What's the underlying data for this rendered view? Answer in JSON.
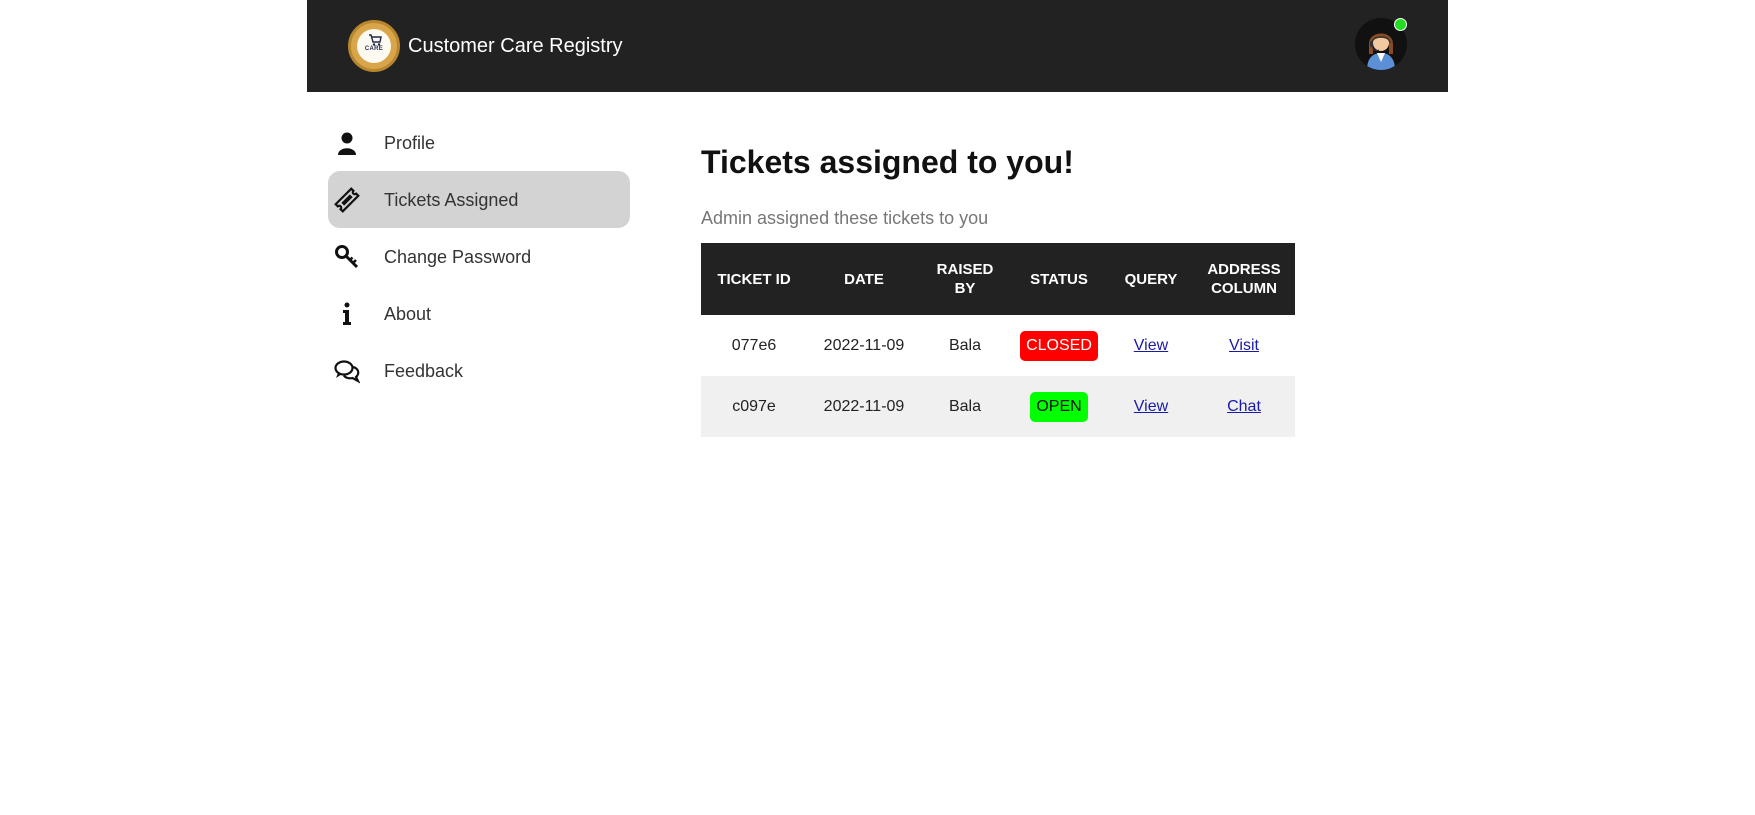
{
  "header": {
    "brand_title": "Customer Care Registry",
    "logo_text": "CARE",
    "avatar_icon": "agent-avatar-icon",
    "online_color": "#22dd22"
  },
  "sidebar": {
    "items": [
      {
        "label": "Profile",
        "icon": "user-icon",
        "active": false
      },
      {
        "label": "Tickets Assigned",
        "icon": "ticket-icon",
        "active": true
      },
      {
        "label": "Change Password",
        "icon": "key-icon",
        "active": false
      },
      {
        "label": "About",
        "icon": "info-icon",
        "active": false
      },
      {
        "label": "Feedback",
        "icon": "chat-bubbles-icon",
        "active": false
      }
    ]
  },
  "main": {
    "title": "Tickets assigned to you!",
    "subtitle": "Admin assigned these tickets to you",
    "table": {
      "headers": [
        "TICKET ID",
        "DATE",
        "RAISED BY",
        "STATUS",
        "QUERY",
        "ADDRESS COLUMN"
      ],
      "rows": [
        {
          "ticket_id": "077e6",
          "date": "2022-11-09",
          "raised_by": "Bala",
          "status": "CLOSED",
          "query": "View",
          "address": "Visit"
        },
        {
          "ticket_id": "c097e",
          "date": "2022-11-09",
          "raised_by": "Bala",
          "status": "OPEN",
          "query": "View",
          "address": "Chat"
        }
      ]
    }
  },
  "colors": {
    "header_bg": "#222222",
    "active_item_bg": "#d3d3d3",
    "closed_badge": "#ff0000",
    "open_badge": "#00ff00",
    "link": "#1a1aa8"
  }
}
